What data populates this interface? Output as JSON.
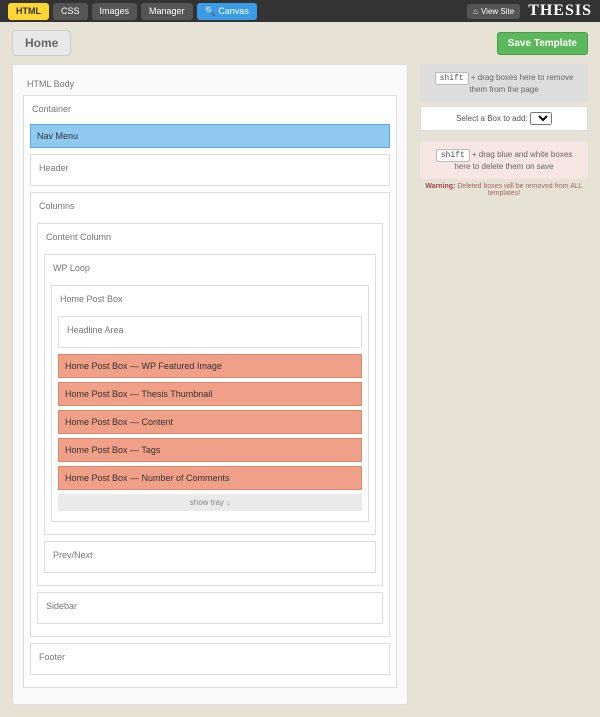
{
  "topbar": {
    "tabs": [
      "HTML",
      "CSS",
      "Images",
      "Manager",
      "Canvas"
    ],
    "canvas_icon": "🔍",
    "view_site": "View Site",
    "home_icon": "⌂",
    "logo": "THESIS"
  },
  "header": {
    "title": "Home",
    "save": "Save Template"
  },
  "body_label": "HTML Body",
  "container": {
    "label": "Container",
    "nav": "Nav Menu",
    "header_box": "Header",
    "columns": {
      "label": "Columns",
      "content": {
        "label": "Content Column",
        "wploop": {
          "label": "WP Loop",
          "postbox": {
            "label": "Home Post Box",
            "headline": "Headline Area",
            "items": [
              "Home Post Box — WP Featured Image",
              "Home Post Box — Thesis Thumbnail",
              "Home Post Box — Content",
              "Home Post Box — Tags",
              "Home Post Box — Number of Comments"
            ],
            "tray": "show tray ↓"
          }
        },
        "prevnext": "Prev/Next"
      },
      "sidebar": "Sidebar"
    },
    "footer": "Footer"
  },
  "right": {
    "shift": "shift",
    "remove_text": " + drag boxes here to remove them from the page",
    "select_label": "Select a Box to add:",
    "delete_text": " + drag blue and white boxes here to delete them on save",
    "warning_label": "Warning:",
    "warning_text": " Deleted boxes will be removed from ALL templates!"
  }
}
